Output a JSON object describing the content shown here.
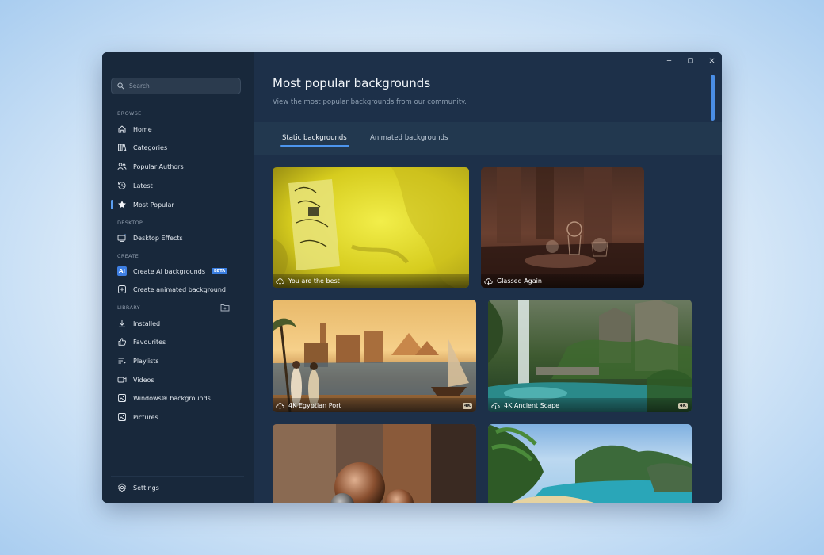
{
  "sidebar": {
    "search_placeholder": "Search",
    "sections": {
      "browse": "BROWSE",
      "desktop": "DESKTOP",
      "create": "CREATE",
      "library": "LIBRARY"
    },
    "items": [
      {
        "label": "Home",
        "icon": "home-icon"
      },
      {
        "label": "Categories",
        "icon": "library-icon"
      },
      {
        "label": "Popular Authors",
        "icon": "people-icon"
      },
      {
        "label": "Latest",
        "icon": "history-icon"
      },
      {
        "label": "Most Popular",
        "icon": "star-icon",
        "active": true
      },
      {
        "label": "Desktop Effects",
        "icon": "desktop-effects-icon"
      },
      {
        "label": "Create AI backgrounds",
        "icon": "ai-icon",
        "badge": "BETA"
      },
      {
        "label": "Create animated background",
        "icon": "add-animated-icon"
      },
      {
        "label": "Installed",
        "icon": "download-icon"
      },
      {
        "label": "Favourites",
        "icon": "thumb-like-icon"
      },
      {
        "label": "Playlists",
        "icon": "playlist-icon"
      },
      {
        "label": "Videos",
        "icon": "video-icon"
      },
      {
        "label": "Windows® backgrounds",
        "icon": "windows-image-icon"
      },
      {
        "label": "Pictures",
        "icon": "picture-icon"
      }
    ],
    "ai_badge_text": "AI",
    "settings_label": "Settings"
  },
  "main": {
    "title": "Most popular backgrounds",
    "subtitle": "View the most popular backgrounds from our community.",
    "tabs": [
      {
        "label": "Static backgrounds",
        "active": true
      },
      {
        "label": "Animated backgrounds",
        "active": false
      }
    ],
    "cards": [
      {
        "title": "You are the best",
        "badge": ""
      },
      {
        "title": "Glassed Again",
        "badge": ""
      },
      {
        "title": "4K Egyptian Port",
        "badge": "4K"
      },
      {
        "title": "4K Ancient Scape",
        "badge": "4K"
      },
      {
        "title": "",
        "badge": ""
      },
      {
        "title": "",
        "badge": ""
      }
    ]
  },
  "colors": {
    "accent": "#4d95ee",
    "sidebar_bg": "#18283b",
    "main_bg": "#1d3049"
  }
}
